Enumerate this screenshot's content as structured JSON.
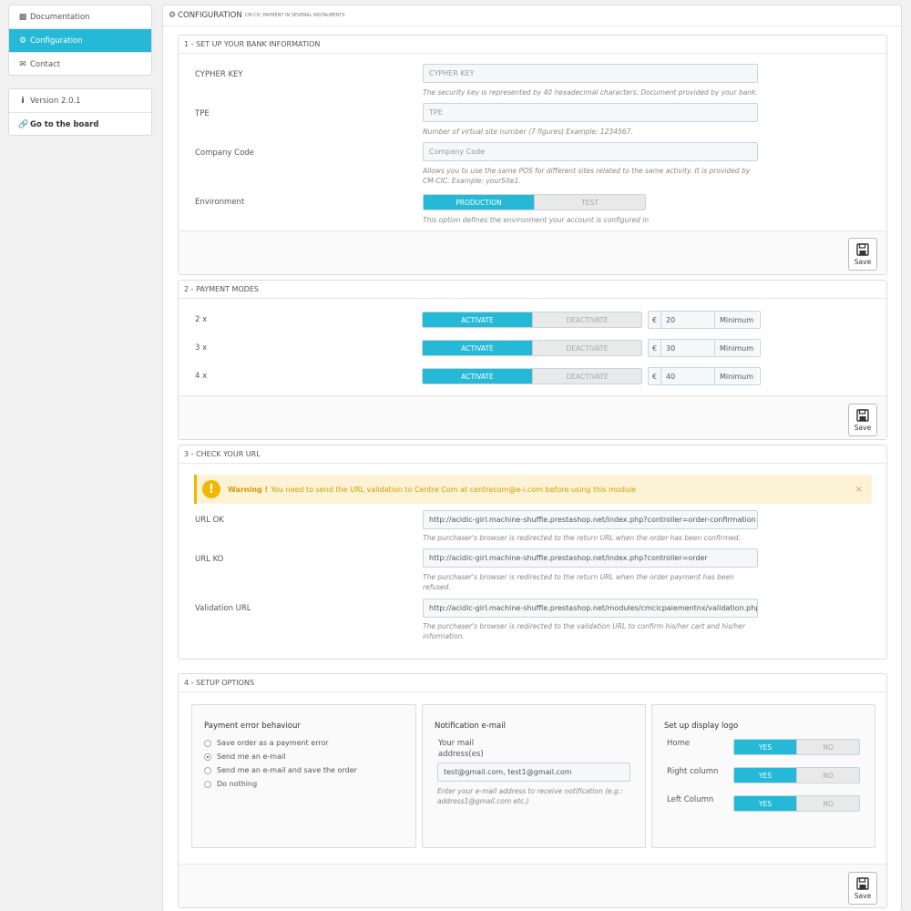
{
  "sidebar": {
    "items": [
      {
        "label": "Documentation",
        "icon": "book-icon"
      },
      {
        "label": "Configuration",
        "icon": "cogs-icon"
      },
      {
        "label": "Contact",
        "icon": "envelope-icon"
      }
    ],
    "version": "Version 2.0.1",
    "board_link": "Go to the board"
  },
  "header": {
    "title": "CONFIGURATION",
    "subtitle": "CM-CIC PAYMENT IN SEVERAL INSTALMENTS"
  },
  "bank": {
    "title": "1 - SET UP YOUR BANK INFORMATION",
    "cypher_label": "CYPHER KEY",
    "cypher_placeholder": "CYPHER KEY",
    "cypher_help": "The security key is represented by 40 hexadecimal characters. Document provided by your bank.",
    "tpe_label": "TPE",
    "tpe_placeholder": "TPE",
    "tpe_help": "Number of virtual site number (7 figures) Example: 1234567.",
    "company_label": "Company Code",
    "company_placeholder": "Company Code",
    "company_help": "Allows you to use the same POS for different sites related to the same activity. It is provided by CM-CIC. Example: yourSite1.",
    "env_label": "Environment",
    "env_on": "PRODUCTION",
    "env_off": "TEST",
    "env_help": "This option defines the environment your account is configured in",
    "save": "Save"
  },
  "payment": {
    "title": "2 - PAYMENT MODES",
    "modes": [
      {
        "label": "2 x",
        "value": "20"
      },
      {
        "label": "3 x",
        "value": "30"
      },
      {
        "label": "4 x",
        "value": "40"
      }
    ],
    "activate": "ACTIVATE",
    "deactivate": "DEACTIVATE",
    "currency": "€",
    "minimum": "Minimum",
    "save": "Save"
  },
  "url": {
    "title": "3 - CHECK YOUR URL",
    "warning_strong": "Warning !",
    "warning_text": "You need to send the URL validation to Centre Com at centrecom@e-i.com before using this module",
    "warning_close": "×",
    "ok_label": "URL OK",
    "ok_value": "http://acidic-girl.machine-shuffle.prestashop.net/index.php?controller=order-confirmation",
    "ok_help": "The purchaser's browser is redirected to the return URL when the order has been confirmed.",
    "ko_label": "URL KO",
    "ko_value": "http://acidic-girl.machine-shuffle.prestashop.net/index.php?controller=order",
    "ko_help": "The purchaser's browser is redirected to the return URL when the order payment has been refused.",
    "val_label": "Validation URL",
    "val_value": "http://acidic-girl.machine-shuffle.prestashop.net/modules/cmcicpaiementnx/validation.php",
    "val_help": "The purchaser's browser is redirected to the validation URL to confirm his/her cart and his/her information."
  },
  "options": {
    "title": "4 - SETUP OPTIONS",
    "error_title": "Payment error behaviour",
    "error_options": [
      {
        "label": "Save order as a payment error",
        "selected": false
      },
      {
        "label": "Send me an e-mail",
        "selected": true
      },
      {
        "label": "Send me an e-mail and save the order",
        "selected": false
      },
      {
        "label": "Do nothing",
        "selected": false
      }
    ],
    "notif_title": "Notification e-mail",
    "notif_label_1": "Your mail",
    "notif_label_2": "address(es)",
    "notif_value": "test@gmail.com, test1@gmail.com",
    "notif_help": "Enter your e-mail address to receive notification (e.g.: address1@gmail.com etc.)",
    "logo_title": "Set up display logo",
    "logo_rows": [
      {
        "label": "Home"
      },
      {
        "label": "Right column"
      },
      {
        "label": "Left Column"
      }
    ],
    "yes": "YES",
    "no": "NO",
    "save": "Save"
  },
  "colors": {
    "accent": "#25b9d7",
    "warning_bg": "#fcf3d6",
    "warning_icon": "#f0b800"
  }
}
